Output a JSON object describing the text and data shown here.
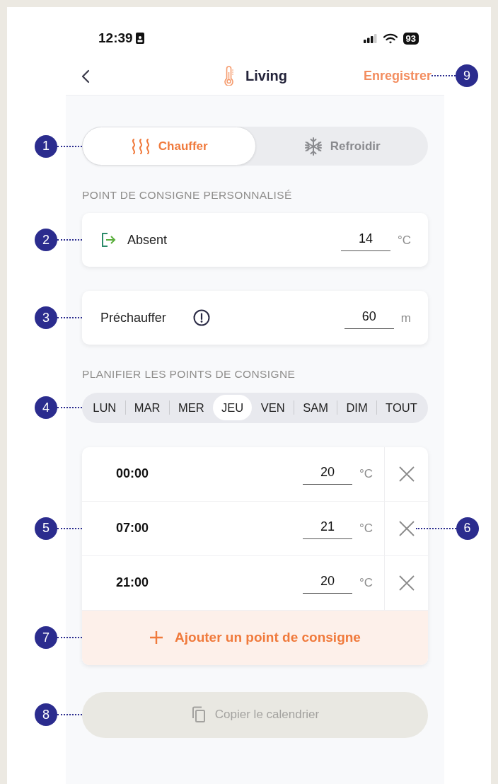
{
  "status_bar": {
    "time": "12:39",
    "battery": "93"
  },
  "header": {
    "title": "Living",
    "save": {
      "label": "Enregistrer",
      "callout": "9"
    }
  },
  "mode_switch": {
    "callout": "1",
    "tabs": [
      {
        "kind": "heat",
        "label": "Chauffer",
        "selected": true
      },
      {
        "kind": "cool",
        "label": "Refroidir",
        "selected": false
      }
    ]
  },
  "custom_section": {
    "title": "POINT DE CONSIGNE PERSONNALISÉ",
    "settings": [
      {
        "kind": "away",
        "label": "Absent",
        "value": "14",
        "unit": "°C",
        "callout": "2"
      },
      {
        "kind": "preheat",
        "label": "Préchauffer",
        "value": "60",
        "unit": "m",
        "callout": "3"
      }
    ]
  },
  "schedule_section": {
    "title": "PLANIFIER LES POINTS DE CONSIGNE",
    "days_callout": "4",
    "days": [
      {
        "label": "LUN",
        "selected": false
      },
      {
        "label": "MAR",
        "selected": false
      },
      {
        "label": "MER",
        "selected": false
      },
      {
        "label": "JEU",
        "selected": true
      },
      {
        "label": "VEN",
        "selected": false
      },
      {
        "label": "SAM",
        "selected": false
      },
      {
        "label": "DIM",
        "selected": false
      },
      {
        "label": "TOUT",
        "selected": false
      }
    ],
    "setpoints": [
      {
        "time": "00:00",
        "value": "20",
        "unit": "°C"
      },
      {
        "time": "07:00",
        "value": "21",
        "unit": "°C",
        "callout": "5",
        "delete_callout": "6"
      },
      {
        "time": "21:00",
        "value": "20",
        "unit": "°C"
      }
    ],
    "add": {
      "label": "Ajouter un point de consigne",
      "callout": "7"
    }
  },
  "copy_button": {
    "label": "Copier le calendrier",
    "disabled": true,
    "callout": "8"
  }
}
